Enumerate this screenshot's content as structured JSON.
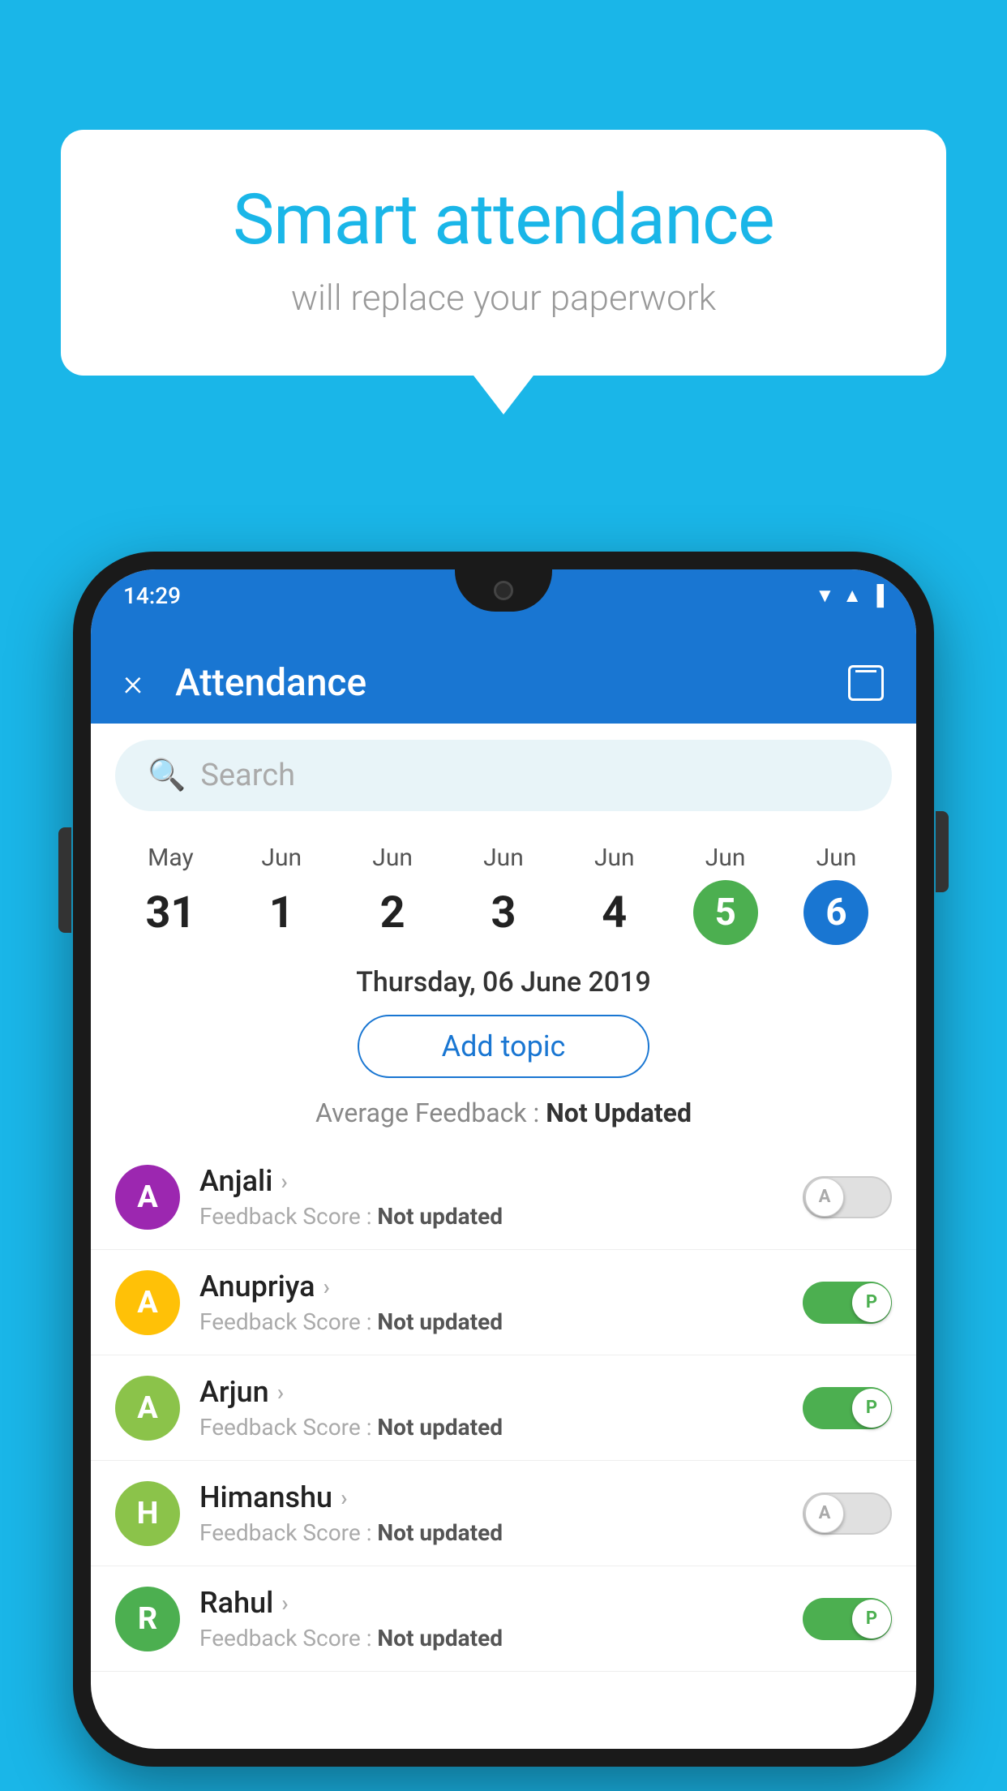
{
  "page": {
    "background_color": "#1ab6e8"
  },
  "speech_bubble": {
    "title": "Smart attendance",
    "subtitle": "will replace your paperwork"
  },
  "phone": {
    "status_bar": {
      "time": "14:29",
      "icons": [
        "▼",
        "▲",
        "▐"
      ]
    },
    "header": {
      "close_label": "×",
      "title": "Attendance",
      "calendar_icon": "calendar-icon"
    },
    "search": {
      "placeholder": "Search"
    },
    "calendar": {
      "days": [
        {
          "month": "May",
          "num": "31",
          "state": "normal"
        },
        {
          "month": "Jun",
          "num": "1",
          "state": "normal"
        },
        {
          "month": "Jun",
          "num": "2",
          "state": "normal"
        },
        {
          "month": "Jun",
          "num": "3",
          "state": "normal"
        },
        {
          "month": "Jun",
          "num": "4",
          "state": "normal"
        },
        {
          "month": "Jun",
          "num": "5",
          "state": "today"
        },
        {
          "month": "Jun",
          "num": "6",
          "state": "selected"
        }
      ]
    },
    "selected_date": "Thursday, 06 June 2019",
    "add_topic_label": "Add topic",
    "avg_feedback_label": "Average Feedback :",
    "avg_feedback_value": "Not Updated",
    "students": [
      {
        "name": "Anjali",
        "avatar_letter": "A",
        "avatar_color": "#9c27b0",
        "feedback_label": "Feedback Score :",
        "feedback_value": "Not updated",
        "toggle_state": "off",
        "toggle_label": "A"
      },
      {
        "name": "Anupriya",
        "avatar_letter": "A",
        "avatar_color": "#ffc107",
        "feedback_label": "Feedback Score :",
        "feedback_value": "Not updated",
        "toggle_state": "on",
        "toggle_label": "P"
      },
      {
        "name": "Arjun",
        "avatar_letter": "A",
        "avatar_color": "#8bc34a",
        "feedback_label": "Feedback Score :",
        "feedback_value": "Not updated",
        "toggle_state": "on",
        "toggle_label": "P"
      },
      {
        "name": "Himanshu",
        "avatar_letter": "H",
        "avatar_color": "#8bc34a",
        "feedback_label": "Feedback Score :",
        "feedback_value": "Not updated",
        "toggle_state": "off",
        "toggle_label": "A"
      },
      {
        "name": "Rahul",
        "avatar_letter": "R",
        "avatar_color": "#4caf50",
        "feedback_label": "Feedback Score :",
        "feedback_value": "Not updated",
        "toggle_state": "on",
        "toggle_label": "P"
      }
    ]
  }
}
